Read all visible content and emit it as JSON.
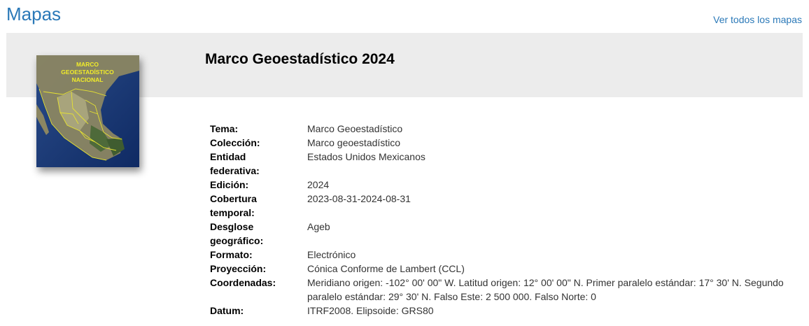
{
  "header": {
    "title": "Mapas",
    "all_maps_link": "Ver todos los mapas"
  },
  "map": {
    "title": "Marco Geoestadístico 2024",
    "thumbnail_caption": [
      "MARCO",
      "GEOESTADÍSTICO",
      "NACIONAL"
    ]
  },
  "metadata": [
    {
      "label": "Tema:",
      "value": "Marco Geoestadístico"
    },
    {
      "label": "Colección:",
      "value": "Marco geoestadístico"
    },
    {
      "label": "Entidad federativa:",
      "value": "Estados Unidos Mexicanos"
    },
    {
      "label": "Edición:",
      "value": "2024"
    },
    {
      "label": "Cobertura temporal:",
      "value": "2023-08-31-2024-08-31"
    },
    {
      "label": "Desglose geográfico:",
      "value": "Ageb"
    },
    {
      "label": "Formato:",
      "value": "Electrónico"
    },
    {
      "label": "Proyección:",
      "value": "Cónica Conforme de Lambert (CCL)"
    },
    {
      "label": "Coordenadas:",
      "value": "Meridiano origen: -102° 00' 00\" W. Latitud origen: 12° 00' 00\" N. Primer paralelo estándar: 17° 30' N. Segundo paralelo estándar: 29° 30' N. Falso Este: 2 500 000. Falso Norte: 0"
    },
    {
      "label": "Datum:",
      "value": "ITRF2008. Elipsoide: GRS80"
    }
  ]
}
